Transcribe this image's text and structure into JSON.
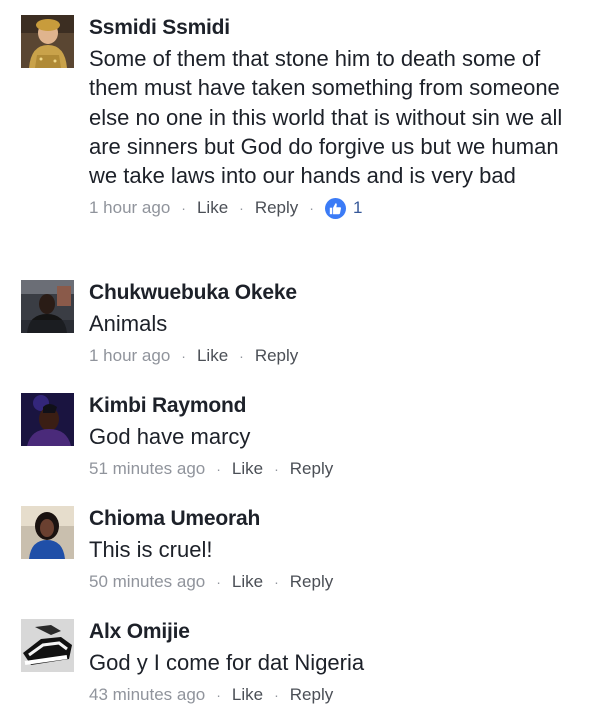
{
  "comments": [
    {
      "author": "Ssmidi Ssmidi",
      "text": "Some of them that stone him to death some of them must have taken something from someone else no one in this world that is without sin we all are sinners but God do forgive us but we human we take laws into our hands and is very bad",
      "time": "1 hour ago",
      "like_label": "Like",
      "reply_label": "Reply",
      "reaction_count": "1",
      "avatar_icon": "baby-in-gold-outfit-avatar"
    },
    {
      "author": "Chukwuebuka Okeke",
      "text": "Animals",
      "time": "1 hour ago",
      "like_label": "Like",
      "reply_label": "Reply",
      "avatar_icon": "man-indoors-avatar"
    },
    {
      "author": "Kimbi Raymond",
      "text": "God have marcy",
      "time": "51 minutes ago",
      "like_label": "Like",
      "reply_label": "Reply",
      "avatar_icon": "dark-portrait-avatar"
    },
    {
      "author": "Chioma Umeorah",
      "text": "This is cruel!",
      "time": "50 minutes ago",
      "like_label": "Like",
      "reply_label": "Reply",
      "avatar_icon": "woman-blue-top-avatar"
    },
    {
      "author": "Alx Omijie",
      "text": "God y I come for dat Nigeria",
      "time": "43 minutes ago",
      "like_label": "Like",
      "reply_label": "Reply",
      "avatar_icon": "black-white-sneakers-avatar"
    }
  ],
  "colors": {
    "name": "#1d2129",
    "meta": "#90949c",
    "like_badge": "#3b7bf6",
    "reaction_count": "#365899"
  },
  "meta_separator": "·"
}
